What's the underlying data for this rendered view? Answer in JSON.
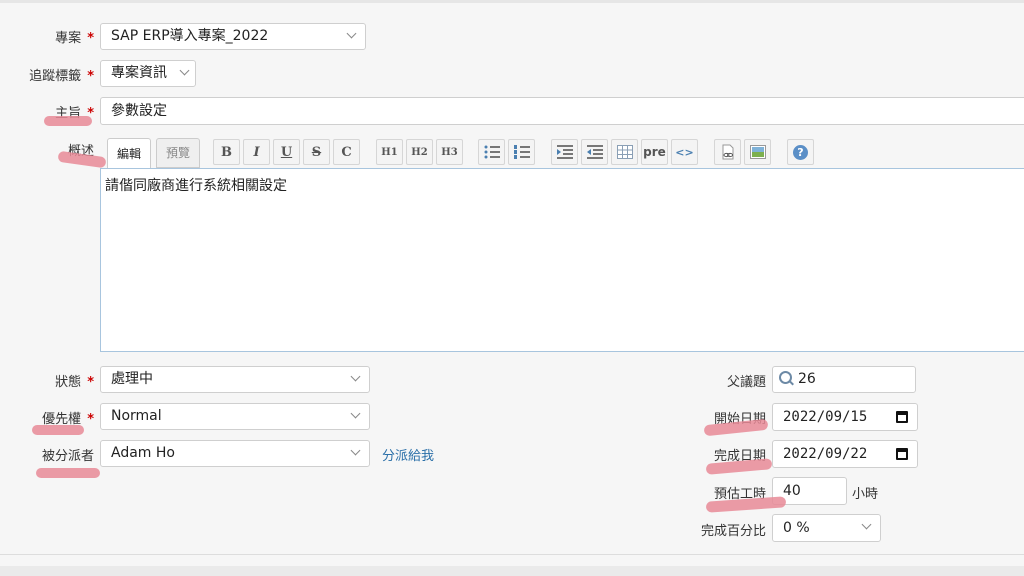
{
  "project": {
    "label": "專案",
    "value": "SAP ERP導入專案_2022"
  },
  "tracker": {
    "label": "追蹤標籤",
    "value": "專案資訊"
  },
  "subject": {
    "label": "主旨",
    "value": "參數設定"
  },
  "description": {
    "label": "概述",
    "tabs": {
      "edit": "編輯",
      "preview": "預覽"
    },
    "toolbar": {
      "bold": "B",
      "italic": "I",
      "underline": "U",
      "strike": "S",
      "code": "C",
      "h1": "H1",
      "h2": "H2",
      "h3": "H3",
      "pre": "pre",
      "code_tag": "<>",
      "help": "?"
    },
    "content": "請偕同廠商進行系統相關設定"
  },
  "status": {
    "label": "狀態",
    "value": "處理中"
  },
  "priority": {
    "label": "優先權",
    "value": "Normal"
  },
  "assignee": {
    "label": "被分派者",
    "value": "Adam Ho",
    "assign_to_me": "分派給我"
  },
  "parent_issue": {
    "label": "父議題",
    "value": "26"
  },
  "start_date": {
    "label": "開始日期",
    "value": "2022/09/15"
  },
  "due_date": {
    "label": "完成日期",
    "value": "2022/09/22"
  },
  "estimated_time": {
    "label": "預估工時",
    "value": "40",
    "unit": "小時"
  },
  "done_ratio": {
    "label": "完成百分比",
    "value": "0 %"
  },
  "required_marker": "*",
  "colors": {
    "required": "#cc0000",
    "highlight": "#e88a96",
    "link": "#2a6fa8",
    "editor_border": "#a8c5de"
  }
}
